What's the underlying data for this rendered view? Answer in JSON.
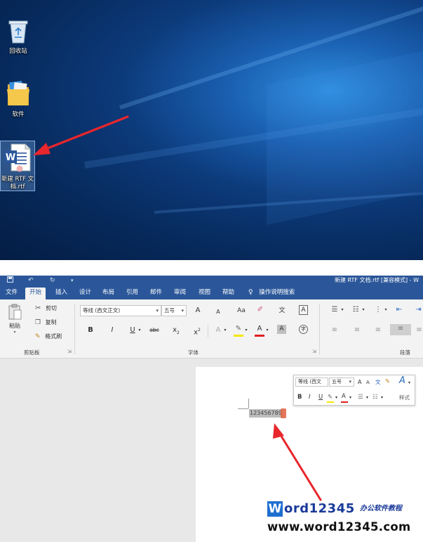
{
  "desktop": {
    "icons": [
      {
        "label": "回收站",
        "icon": "recycle-bin-icon"
      },
      {
        "label": "软件",
        "icon": "folder-icon"
      },
      {
        "label_line1": "新建 RTF 文",
        "label_line2": "档.rtf",
        "icon": "word-document-icon",
        "selected": true
      }
    ]
  },
  "word": {
    "window_title": "新建 RTF 文档.rtf [兼容模式] - W",
    "qat": {
      "save": "save-icon",
      "undo": "undo-icon",
      "redo": "redo-icon",
      "customize": "customize-qat-icon"
    },
    "tabs": [
      "文件",
      "开始",
      "插入",
      "设计",
      "布局",
      "引用",
      "邮件",
      "审阅",
      "视图",
      "帮助"
    ],
    "active_tab": "开始",
    "tell_me": "操作说明搜索",
    "clipboard": {
      "paste": "粘贴",
      "cut": "剪切",
      "copy": "复制",
      "format_painter": "格式刷",
      "group": "剪贴板"
    },
    "font": {
      "font_name": "等线 (西文正文)",
      "font_size": "五号",
      "grow": "A",
      "shrink": "A",
      "change_case": "Aa",
      "phonetic": "文",
      "char_border": "A",
      "bold": "B",
      "italic": "I",
      "underline": "U",
      "strikethrough": "abc",
      "subscript": "x",
      "sub_mark": "2",
      "superscript": "x",
      "sup_mark": "2",
      "text_effects": "A",
      "font_color": "A",
      "char_shading": "A",
      "enclose": "字",
      "group": "字体",
      "highlight_color": "#f5e800",
      "font_color_value": "#e02020"
    },
    "paragraph": {
      "group": "段落"
    },
    "document": {
      "selected_text": "123456789"
    },
    "mini_toolbar": {
      "font_name": "等线 (西文",
      "font_size": "五号",
      "grow": "A",
      "shrink": "A",
      "phonetic": "文",
      "bold": "B",
      "italic": "I",
      "underline": "U",
      "font_color": "A",
      "styles": "样式",
      "styles_icon": "A"
    }
  },
  "watermark": {
    "brand_initial": "W",
    "brand_rest": "ord12345",
    "tagline": "办公软件教程",
    "url": "www.word12345.com"
  },
  "colors": {
    "word_blue": "#2b579a",
    "arrow_red": "#e8262c"
  }
}
